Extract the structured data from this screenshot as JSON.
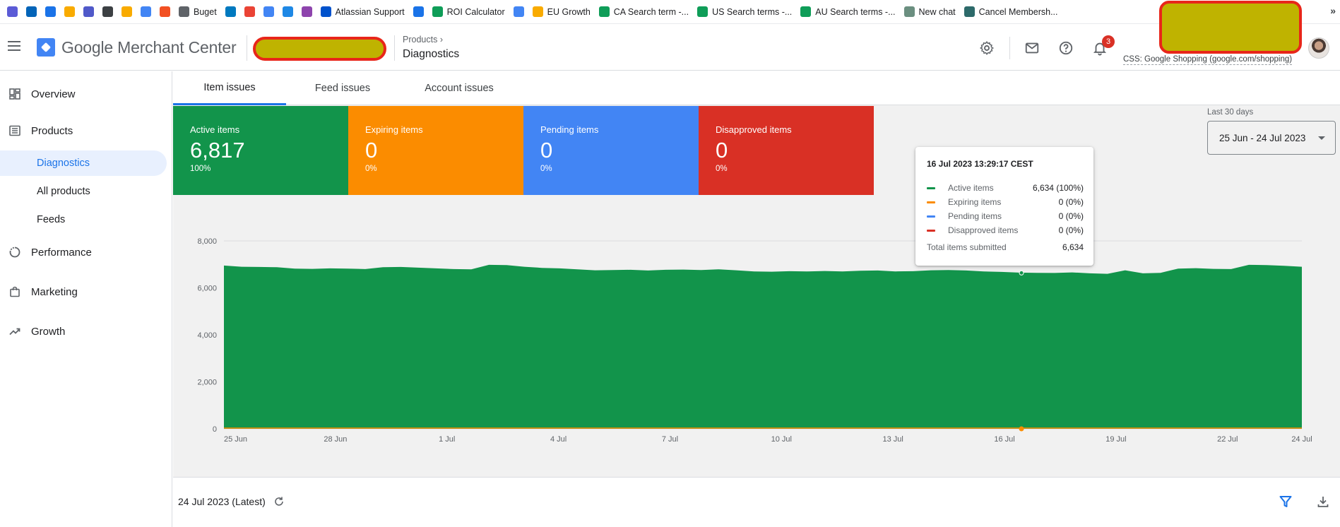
{
  "bookmarks": [
    {
      "label": "",
      "color": "#5b5bd6"
    },
    {
      "label": "",
      "color": "#0364b8"
    },
    {
      "label": "",
      "color": "#1a73e8"
    },
    {
      "label": "",
      "color": "#f9ab00"
    },
    {
      "label": "",
      "color": "#5059c9"
    },
    {
      "label": "",
      "color": "#3c4043"
    },
    {
      "label": "",
      "color": "#f9ab00"
    },
    {
      "label": "",
      "color": "#4285f4"
    },
    {
      "label": "",
      "color": "#f25022"
    },
    {
      "label": "Buget",
      "color": "#5f6368"
    },
    {
      "label": "",
      "color": "#0079bf"
    },
    {
      "label": "",
      "color": "#ea4335"
    },
    {
      "label": "",
      "color": "#4285f4"
    },
    {
      "label": "",
      "color": "#1e88e5"
    },
    {
      "label": "",
      "color": "#8e44ad"
    },
    {
      "label": "Atlassian Support",
      "color": "#0052cc"
    },
    {
      "label": "",
      "color": "#1a73e8"
    },
    {
      "label": "ROI Calculator",
      "color": "#0f9d58"
    },
    {
      "label": "",
      "color": "#4285f4"
    },
    {
      "label": "EU Growth",
      "color": "#f9ab00"
    },
    {
      "label": "CA Search term -...",
      "color": "#0f9d58"
    },
    {
      "label": "US Search terms -...",
      "color": "#0f9d58"
    },
    {
      "label": "AU Search terms -...",
      "color": "#0f9d58"
    },
    {
      "label": "New chat",
      "color": "#6b8f80"
    },
    {
      "label": "Cancel Membersh...",
      "color": "#2d6a6a"
    }
  ],
  "header": {
    "logo_text": "Google Merchant Center",
    "breadcrumb_parent": "Products",
    "page_title": "Diagnostics",
    "notification_count": "3",
    "css_label": "CSS: Google Shopping (google.com/shopping)"
  },
  "sidebar": {
    "overview": "Overview",
    "products": "Products",
    "diagnostics": "Diagnostics",
    "all_products": "All products",
    "feeds": "Feeds",
    "performance": "Performance",
    "marketing": "Marketing",
    "growth": "Growth"
  },
  "tabs": {
    "item_issues": "Item issues",
    "feed_issues": "Feed issues",
    "account_issues": "Account issues"
  },
  "tiles": [
    {
      "label": "Active items",
      "value": "6,817",
      "pct": "100%",
      "color": "#12944b"
    },
    {
      "label": "Expiring items",
      "value": "0",
      "pct": "0%",
      "color": "#fb8c00"
    },
    {
      "label": "Pending items",
      "value": "0",
      "pct": "0%",
      "color": "#4285f4"
    },
    {
      "label": "Disapproved items",
      "value": "0",
      "pct": "0%",
      "color": "#d93025"
    }
  ],
  "date_range": {
    "caption": "Last 30 days",
    "value": "25 Jun - 24 Jul 2023"
  },
  "tooltip": {
    "title": "16 Jul 2023 13:29:17 CEST",
    "rows": [
      {
        "name": "Active items",
        "value": "6,634 (100%)",
        "color": "#12944b"
      },
      {
        "name": "Expiring items",
        "value": "0 (0%)",
        "color": "#fb8c00"
      },
      {
        "name": "Pending items",
        "value": "0 (0%)",
        "color": "#4285f4"
      },
      {
        "name": "Disapproved items",
        "value": "0 (0%)",
        "color": "#d93025"
      }
    ],
    "total_label": "Total items submitted",
    "total_value": "6,634"
  },
  "bottom": {
    "latest": "24 Jul 2023 (Latest)"
  },
  "chart_data": {
    "type": "area",
    "series": [
      {
        "name": "Active items",
        "color": "#12944b"
      },
      {
        "name": "Expiring items",
        "color": "#fb8c00"
      },
      {
        "name": "Pending items",
        "color": "#4285f4"
      },
      {
        "name": "Disapproved items",
        "color": "#d93025"
      }
    ],
    "active_values": [
      6950,
      6900,
      6890,
      6880,
      6820,
      6810,
      6830,
      6820,
      6800,
      6880,
      6890,
      6860,
      6830,
      6800,
      6790,
      6980,
      6970,
      6900,
      6850,
      6830,
      6790,
      6750,
      6760,
      6770,
      6740,
      6770,
      6780,
      6760,
      6790,
      6750,
      6700,
      6690,
      6710,
      6700,
      6720,
      6700,
      6730,
      6740,
      6700,
      6710,
      6750,
      6760,
      6740,
      6700,
      6680,
      6650,
      6640,
      6634,
      6660,
      6620,
      6600,
      6750,
      6620,
      6640,
      6820,
      6840,
      6810,
      6800,
      6980,
      6970,
      6940,
      6900
    ],
    "x_start": "2023-06-25",
    "x_end": "2023-07-24",
    "xticks": [
      "25 Jun",
      "28 Jun",
      "1 Jul",
      "4 Jul",
      "7 Jul",
      "10 Jul",
      "13 Jul",
      "16 Jul",
      "19 Jul",
      "22 Jul",
      "24 Jul"
    ],
    "yticks": [
      "0",
      "2,000",
      "4,000",
      "6,000",
      "8,000"
    ],
    "ylim": [
      0,
      8000
    ],
    "grid": true,
    "hover_date": "2023-07-16"
  }
}
